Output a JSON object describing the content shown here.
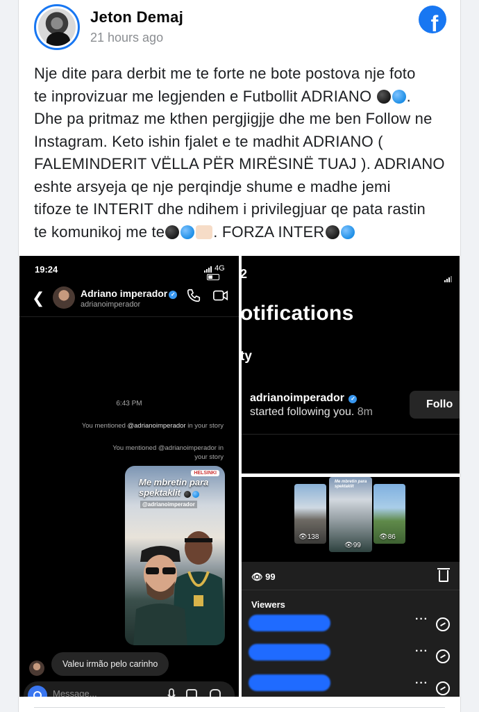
{
  "post": {
    "author": "Jeton Demaj",
    "time": "21 hours ago",
    "text_lines": [
      "Nje dite para derbit me te forte ne bote postova nje foto",
      "te inprovizuar me legjenden e Futbollit ADRIANO",
      "Dhe pa pritmaz me kthen pergjigjje dhe me ben Follow ne",
      "Instagram. Keto ishin fjalet e te madhit ADRIANO (",
      "FALEMINDERIT VËLLA PËR MIRËSINË TUAJ ). ADRIANO",
      "eshte arsyeja qe nje perqindje shume e madhe jemi",
      "tifoze te INTERIT dhe ndihem i privilegjuar qe pata rastin",
      "te komunikoj me te",
      ". FORZA INTER"
    ],
    "colors": {
      "brand": "#1877f2",
      "text": "#1c1e21",
      "meta": "#8a8d91"
    }
  },
  "dm": {
    "status_time": "19:24",
    "network": "4G",
    "contact_name": "Adriano imperador",
    "contact_handle": "adrianoimperador",
    "chat_time": "6:43 PM",
    "mention1_prefix": "You mentioned ",
    "mention1_handle": "@adrianoimperador",
    "mention1_suffix": " in your story",
    "mention2_line1": "You mentioned @adrianoimperador in",
    "mention2_line2": "your story",
    "story_location": "HELSINKI",
    "story_caption_1": "Me mbretin para",
    "story_caption_2": "spektaklit",
    "story_tag": "@adrianoimperador",
    "reply": "Valeu irmão pelo carinho",
    "composer_placeholder": "Message..."
  },
  "notifications": {
    "status_time_partial": "2",
    "title": "otifications",
    "section": "ty",
    "username": "adrianoimperador",
    "message": "started following you.",
    "age": "8m",
    "follow_label": "Follo"
  },
  "story_views": {
    "counts": [
      "138",
      "99",
      "86"
    ],
    "total_views": "99",
    "viewers_label": "Viewers",
    "caption": "Me mbretin para spektaklit"
  }
}
